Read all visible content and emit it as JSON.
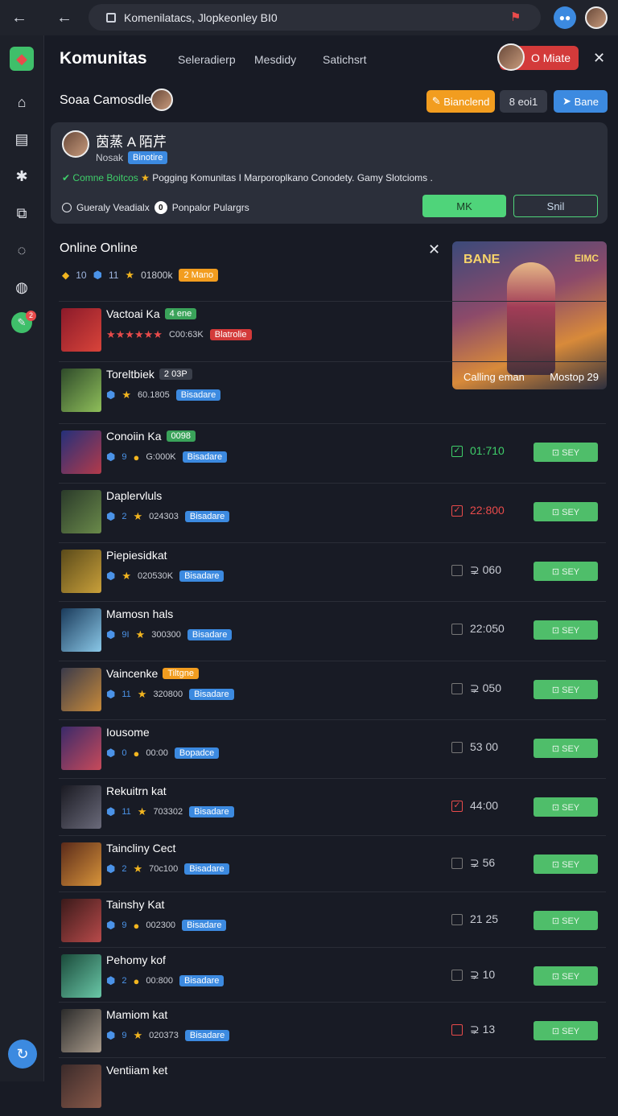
{
  "browser": {
    "url": "Komenilatacs, Jlopkeonley BI0"
  },
  "sidebar": {
    "items": [
      {
        "name": "home-icon",
        "glyph": "⌂"
      },
      {
        "name": "layout-icon",
        "glyph": "▤"
      },
      {
        "name": "gear-icon",
        "glyph": "✱"
      },
      {
        "name": "chart-icon",
        "glyph": "⧉"
      },
      {
        "name": "chat-icon",
        "glyph": "◌"
      },
      {
        "name": "timer-icon",
        "glyph": "◍"
      }
    ],
    "notif_badge": "2"
  },
  "header": {
    "brand": "Komunitas",
    "tabs": [
      "Seleradierp",
      "Mesdidy",
      "Satichsrt"
    ],
    "user_label": "O Miate"
  },
  "community": {
    "name": "Soaa Camosdle",
    "btn_orange": "Bianclend",
    "btn_dark": "8 eoi1",
    "btn_blue": "Bane"
  },
  "card": {
    "title": "茵蒸 A 陌芹",
    "sub_label": "Nosak",
    "sub_badge": "Binotire",
    "desc_green": "Comne Boitcos",
    "desc_rest": "Pogging Komunitas I Marporoplkano Conodety. Gamy Slotcioms .",
    "foot_left": "Gueraly  Veadialx",
    "foot_count": "0",
    "foot_right": "Ponpalor  Pulargrs",
    "btn_primary": "MK",
    "btn_secondary": "Snil"
  },
  "online": {
    "title": "Online Online",
    "stat_a": "10",
    "stat_b": "11",
    "stat_c": "01800k",
    "stat_badge": "2 Mano"
  },
  "feature": {
    "caption_left": "Calling eman",
    "caption_right": "Mostop 29",
    "title_text": "BANE",
    "corner_text": "EIMC"
  },
  "rows": [
    {
      "name": "Vactoai Ka",
      "tag": "4 ene",
      "tag_color": "#3aa35a",
      "lvl": "",
      "score": "C00:63K",
      "badge": "Blatrolie",
      "badge_color": "#d33a3a",
      "check": "",
      "time": "",
      "go": "",
      "stars": "★★★★★★"
    },
    {
      "name": "Toreltbiek",
      "tag": "2 03P",
      "tag_color": "#3a3f4a",
      "lvl": "",
      "score": "60.1805",
      "badge": "Bisadare",
      "badge_color": "#3c8ae0",
      "check": "",
      "time": "",
      "go": "",
      "stars": "★"
    },
    {
      "name": "Conoiin Ka",
      "tag": "0098",
      "tag_color": "#3aa35a",
      "lvl": "9",
      "score": "G:000K",
      "badge": "Bisadare",
      "badge_color": "#3c8ae0",
      "check": "✓",
      "check_color": "#3fcf6a",
      "time": "01:710",
      "time_color": "#3fcf6a",
      "go": "⊡ SEY",
      "stars": "●"
    },
    {
      "name": "Daplervluls",
      "tag": "",
      "tag_color": "",
      "lvl": "2",
      "score": "024303",
      "badge": "Bisadare",
      "badge_color": "#3c8ae0",
      "check": "✓",
      "check_color": "#e94b4b",
      "time": "22:800",
      "time_color": "#e94b4b",
      "go": "⊡ SEY",
      "stars": "★"
    },
    {
      "name": "Piepiesidkat",
      "tag": "",
      "tag_color": "",
      "lvl": "",
      "score": "020530K",
      "badge": "Bisadare",
      "badge_color": "#3c8ae0",
      "check": "",
      "check_color": "#777",
      "time": "⊋ 060",
      "time_color": "#c9ccd4",
      "go": "⊡ SEY",
      "stars": "★"
    },
    {
      "name": "Mamosn hals",
      "tag": "",
      "tag_color": "",
      "lvl": "9I",
      "score": "300300",
      "badge": "Bisadare",
      "badge_color": "#3c8ae0",
      "check": "",
      "check_color": "#777",
      "time": "22:050",
      "time_color": "#c9ccd4",
      "go": "⊡ SEY",
      "stars": "★"
    },
    {
      "name": "Vaincenke",
      "tag": "Tiltgne",
      "tag_color": "#f29d1f",
      "lvl": "11",
      "score": "320800",
      "badge": "Bisadare",
      "badge_color": "#3c8ae0",
      "check": "",
      "check_color": "#777",
      "time": "⊋ 050",
      "time_color": "#c9ccd4",
      "go": "⊡ SEY",
      "stars": "★"
    },
    {
      "name": "Iousome",
      "tag": "",
      "tag_color": "",
      "lvl": "0",
      "score": "00:00",
      "badge": "Bopadce",
      "badge_color": "#3c8ae0",
      "check": "",
      "check_color": "#777",
      "time": "53 00",
      "time_color": "#c9ccd4",
      "go": "⊡ SEY",
      "stars": "●"
    },
    {
      "name": "Rekuitrn kat",
      "tag": "",
      "tag_color": "",
      "lvl": "11",
      "score": "703302",
      "badge": "Bisadare",
      "badge_color": "#3c8ae0",
      "check": "✓",
      "check_color": "#e94b4b",
      "time": "44:00",
      "time_color": "#c9ccd4",
      "go": "⊡ SEY",
      "stars": "★"
    },
    {
      "name": "Taincliny Cect",
      "tag": "",
      "tag_color": "",
      "lvl": "2",
      "score": "70c100",
      "badge": "Bisadare",
      "badge_color": "#3c8ae0",
      "check": "",
      "check_color": "#777",
      "time": "⊋ 56",
      "time_color": "#c9ccd4",
      "go": "⊡ SEY",
      "stars": "★"
    },
    {
      "name": "Tainshy Kat",
      "tag": "",
      "tag_color": "",
      "lvl": "9",
      "score": "002300",
      "badge": "Bisadare",
      "badge_color": "#3c8ae0",
      "check": "",
      "check_color": "#777",
      "time": "21 25",
      "time_color": "#c9ccd4",
      "go": "⊡ SEY",
      "stars": "●"
    },
    {
      "name": "Pehomy kof",
      "tag": "",
      "tag_color": "",
      "lvl": "2",
      "score": "00:800",
      "badge": "Bisadare",
      "badge_color": "#3c8ae0",
      "check": "",
      "check_color": "#777",
      "time": "⊋ 10",
      "time_color": "#c9ccd4",
      "go": "⊡ SEY",
      "stars": "●"
    },
    {
      "name": "Mamiom kat",
      "tag": "",
      "tag_color": "",
      "lvl": "9",
      "score": "020373",
      "badge": "Bisadare",
      "badge_color": "#3c8ae0",
      "check": "",
      "check_color": "#e94b4b",
      "time": "⊋ 13",
      "time_color": "#c9ccd4",
      "go": "⊡ SEY",
      "stars": "★"
    },
    {
      "name": "Ventiiam ket",
      "tag": "",
      "tag_color": "",
      "lvl": "",
      "score": "",
      "badge": "",
      "badge_color": "",
      "check": "",
      "check_color": "#777",
      "time": "",
      "time_color": "#c9ccd4",
      "go": "",
      "stars": ""
    }
  ]
}
